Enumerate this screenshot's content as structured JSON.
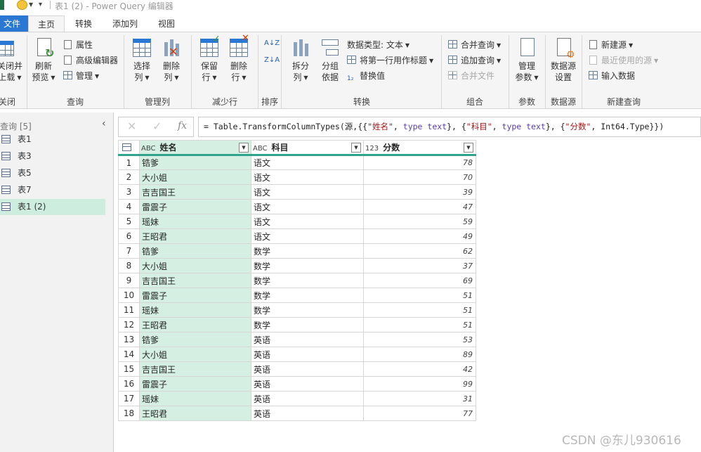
{
  "window": {
    "title": "表1 (2) - Power Query 编辑器"
  },
  "tabs": [
    {
      "label": "文件"
    },
    {
      "label": "主页"
    },
    {
      "label": "转换"
    },
    {
      "label": "添加列"
    },
    {
      "label": "视图"
    }
  ],
  "ribbon": {
    "close_group": {
      "btn_line1": "关闭并",
      "btn_line2": "上载",
      "label": "关闭"
    },
    "query_group": {
      "refresh_line1": "刷新",
      "refresh_line2": "预览",
      "properties": "属性",
      "advanced_editor": "高级编辑器",
      "manage": "管理",
      "label": "查询"
    },
    "manage_cols_group": {
      "choose_line1": "选择",
      "choose_line2": "列",
      "remove_line1": "删除",
      "remove_line2": "列",
      "label": "管理列"
    },
    "reduce_rows_group": {
      "keep_line1": "保留",
      "keep_line2": "行",
      "remove_line1": "删除",
      "remove_line2": "行",
      "label": "减少行"
    },
    "sort_group": {
      "label": "排序"
    },
    "transform_group": {
      "split_line1": "拆分",
      "split_line2": "列",
      "group_line1": "分组",
      "group_line2": "依据",
      "data_type": "数据类型: 文本",
      "first_row_header": "将第一行用作标题",
      "replace_values": "替换值",
      "label": "转换"
    },
    "combine_group": {
      "merge_queries": "合并查询",
      "append_queries": "追加查询",
      "combine_files": "合并文件",
      "label": "组合"
    },
    "params_group": {
      "manage_line1": "管理",
      "manage_line2": "参数",
      "label": "参数"
    },
    "datasource_group": {
      "settings_line1": "数据源",
      "settings_line2": "设置",
      "label": "数据源"
    },
    "newquery_group": {
      "new_source": "新建源",
      "recent_sources": "最近使用的源",
      "enter_data": "输入数据",
      "label": "新建查询"
    }
  },
  "queries_panel": {
    "header": "查询 [5]",
    "items": [
      {
        "label": "表1"
      },
      {
        "label": "表3"
      },
      {
        "label": "表5"
      },
      {
        "label": "表7"
      },
      {
        "label": "表1 (2)"
      }
    ]
  },
  "formula_bar": {
    "cancel": "✕",
    "confirm": "✓",
    "fx": "fx",
    "p1": "= Table.TransformColumnTypes(源,{{",
    "s1": "\"姓名\"",
    "p2": ", ",
    "k1": "type text",
    "p3": "}, {",
    "s2": "\"科目\"",
    "p4": ", ",
    "k2": "type text",
    "p5": "}, {",
    "s3": "\"分数\"",
    "p6": ", Int64.Type}})"
  },
  "table": {
    "columns": [
      {
        "type_icon": "ABC",
        "name": "姓名"
      },
      {
        "type_icon": "ABC",
        "name": "科目"
      },
      {
        "type_icon": "123",
        "name": "分数"
      }
    ],
    "rows": [
      {
        "n": "1",
        "name": "锆爹",
        "subject": "语文",
        "score": "78"
      },
      {
        "n": "2",
        "name": "大小姐",
        "subject": "语文",
        "score": "70"
      },
      {
        "n": "3",
        "name": "吉吉国王",
        "subject": "语文",
        "score": "39"
      },
      {
        "n": "4",
        "name": "雷震子",
        "subject": "语文",
        "score": "47"
      },
      {
        "n": "5",
        "name": "瑶妹",
        "subject": "语文",
        "score": "59"
      },
      {
        "n": "6",
        "name": "王昭君",
        "subject": "语文",
        "score": "49"
      },
      {
        "n": "7",
        "name": "锆爹",
        "subject": "数学",
        "score": "62"
      },
      {
        "n": "8",
        "name": "大小姐",
        "subject": "数学",
        "score": "37"
      },
      {
        "n": "9",
        "name": "吉吉国王",
        "subject": "数学",
        "score": "69"
      },
      {
        "n": "10",
        "name": "雷震子",
        "subject": "数学",
        "score": "51"
      },
      {
        "n": "11",
        "name": "瑶妹",
        "subject": "数学",
        "score": "51"
      },
      {
        "n": "12",
        "name": "王昭君",
        "subject": "数学",
        "score": "51"
      },
      {
        "n": "13",
        "name": "锆爹",
        "subject": "英语",
        "score": "53"
      },
      {
        "n": "14",
        "name": "大小姐",
        "subject": "英语",
        "score": "89"
      },
      {
        "n": "15",
        "name": "吉吉国王",
        "subject": "英语",
        "score": "42"
      },
      {
        "n": "16",
        "name": "雷震子",
        "subject": "英语",
        "score": "99"
      },
      {
        "n": "17",
        "name": "瑶妹",
        "subject": "英语",
        "score": "31"
      },
      {
        "n": "18",
        "name": "王昭君",
        "subject": "英语",
        "score": "77"
      }
    ]
  },
  "watermark": "CSDN @东儿930616",
  "colors": {
    "selected_query": "#cdeede",
    "name_column": "#d5f0e2",
    "header_underline": "#2fa38b",
    "file_tab": "#2b78d4"
  }
}
